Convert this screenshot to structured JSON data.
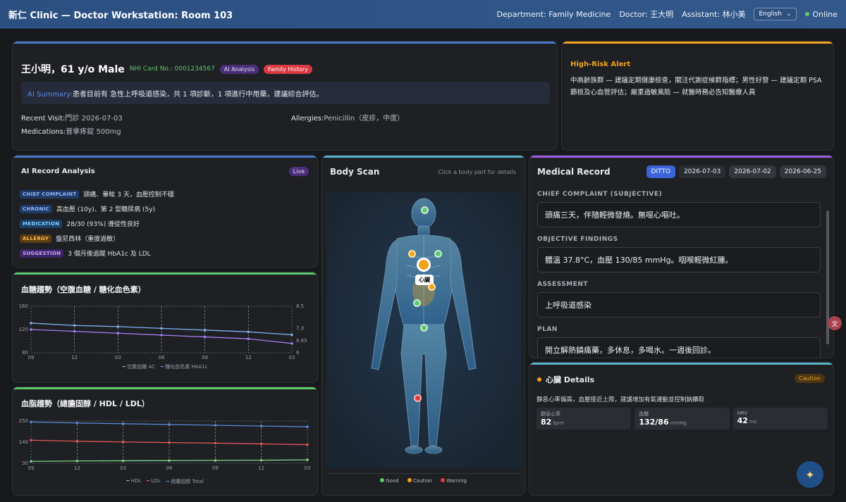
{
  "header": {
    "title": "新仁 Clinic — Doctor Workstation: Room 103",
    "department": "Department: Family Medicine",
    "doctor": "Doctor: 王大明",
    "assistant": "Assistant: 林小美",
    "language": "English",
    "status": "Online"
  },
  "patient": {
    "name": "王小明，61 y/o Male",
    "nhi": "NHI Card No.: 0001234567",
    "ai_badge": "AI Analysis",
    "family_badge": "Family History",
    "ai_summary_label": "AI Summary:",
    "ai_summary": "患者目前有 急性上呼吸道感染，共 1 項診斷，1 項進行中用藥，建議綜合評估。",
    "recent_visit_label": "Recent Visit:",
    "recent_visit": "門診 2026-07-03",
    "allergies_label": "Allergies:",
    "allergies": "Penicillin（皮疹，中度）",
    "medications_label": "Medications:",
    "medications": "普拿疼錠 500mg"
  },
  "alert": {
    "title": "High-Risk Alert",
    "text": "中高齡族群 — 建議定期健康檢查，關注代謝症候群指標；男性好發 — 建議定期 PSA 篩檢及心血管評估；嚴重過敏風險 — 就醫時務必告知醫療人員"
  },
  "ai_record": {
    "title": "AI Record Analysis",
    "badge": "Live",
    "items": [
      {
        "tag": "CHIEF COMPLAINT",
        "text": "頭痛、暈眩 3 天，血壓控制不穩"
      },
      {
        "tag": "CHRONIC",
        "text": "高血壓 (10y)、第 2 型糖尿病 (5y)"
      },
      {
        "tag": "MEDICATION",
        "text": "28/30 (93%) 遵從性良好"
      },
      {
        "tag": "ALLERGY",
        "text": "盤尼西林（重度過敏）"
      },
      {
        "tag": "SUGGESTION",
        "text": "3 個月後追蹤 HbA1c 及 LDL"
      }
    ]
  },
  "glucose_chart": {
    "title": "血糖趨勢（空腹血糖 / 糖化血色素）",
    "legend": [
      "空腹血糖 AC",
      "糖化血色素 HbA1c"
    ]
  },
  "lipid_chart": {
    "title": "血脂趨勢（總膽固醇 / HDL / LDL）",
    "legend": [
      "HDL",
      "LDL",
      "總膽固醇 Total"
    ]
  },
  "chart_data": [
    {
      "type": "line",
      "x": [
        "09",
        "12",
        "03",
        "06",
        "09",
        "12",
        "03"
      ],
      "ylim": [
        80,
        160
      ],
      "y2lim": [
        6,
        8.5
      ],
      "yticks": [
        80,
        120,
        160
      ],
      "y2ticks": [
        "6",
        "6.65",
        "7.3",
        "8.5"
      ],
      "series": [
        {
          "name": "空腹血糖 AC",
          "axis": "left",
          "color": "#7fb2f0",
          "values": [
            131,
            127,
            125,
            122,
            119,
            116,
            111
          ]
        },
        {
          "name": "糖化血色素 HbA1c",
          "axis": "right",
          "color": "#a57cf0",
          "values": [
            7.25,
            7.15,
            7.05,
            6.95,
            6.85,
            6.75,
            6.5
          ]
        }
      ]
    },
    {
      "type": "line",
      "x": [
        "09",
        "12",
        "03",
        "06",
        "09",
        "12",
        "03"
      ],
      "ylim": [
        30,
        250
      ],
      "yticks": [
        30,
        140,
        250
      ],
      "series": [
        {
          "name": "HDL",
          "color": "#7ed38a",
          "values": [
            40,
            42,
            43,
            44,
            45,
            46,
            48
          ]
        },
        {
          "name": "LDL",
          "color": "#e05a5a",
          "values": [
            150,
            145,
            141,
            138,
            135,
            131,
            127
          ]
        },
        {
          "name": "總膽固醇 Total",
          "color": "#5a8bd6",
          "values": [
            245,
            240,
            236,
            232,
            228,
            224,
            220
          ]
        }
      ]
    }
  ],
  "body_scan": {
    "title": "Body Scan",
    "hint": "Click a body part for details",
    "selected_label": "心臟",
    "legend": [
      {
        "label": "Good",
        "color": "#5cc96b"
      },
      {
        "label": "Caution",
        "color": "#f0a21a"
      },
      {
        "label": "Warning",
        "color": "#e03b3b"
      }
    ]
  },
  "medical_record": {
    "title": "Medical Record",
    "ditto": "DITTO",
    "dates": [
      "2026-07-03",
      "2026-07-02",
      "2026-06-25"
    ],
    "chief_label": "CHIEF COMPLAINT (SUBJECTIVE)",
    "chief": "頭痛三天，伴隨輕微發燒。無噁心嘔吐。",
    "objective_label": "OBJECTIVE FINDINGS",
    "objective": "體溫 37.8°C，血壓 130/85 mmHg。咽喉輕微紅腫。",
    "assessment_label": "ASSESSMENT",
    "assessment": "上呼吸道感染",
    "plan_label": "PLAN",
    "plan": "開立解熱鎮痛藥，多休息，多喝水。一週後回診。"
  },
  "heart": {
    "title": "心臟 Details",
    "badge": "Caution",
    "desc": "靜息心率偏高，血壓接近上限，建議增加有氧運動並控制鈉攝取",
    "metrics": [
      {
        "label": "靜息心率",
        "value": "82",
        "unit": "bpm"
      },
      {
        "label": "血壓",
        "value": "132/86",
        "unit": "mmHg"
      },
      {
        "label": "HRV",
        "value": "42",
        "unit": "ms"
      }
    ]
  },
  "colors": {
    "accent_blue": "#4a78c8",
    "accent_orange": "#f0a21a",
    "accent_green": "#5cc96b",
    "accent_teal": "#57b3c9",
    "accent_purple": "#9a5ee0"
  }
}
